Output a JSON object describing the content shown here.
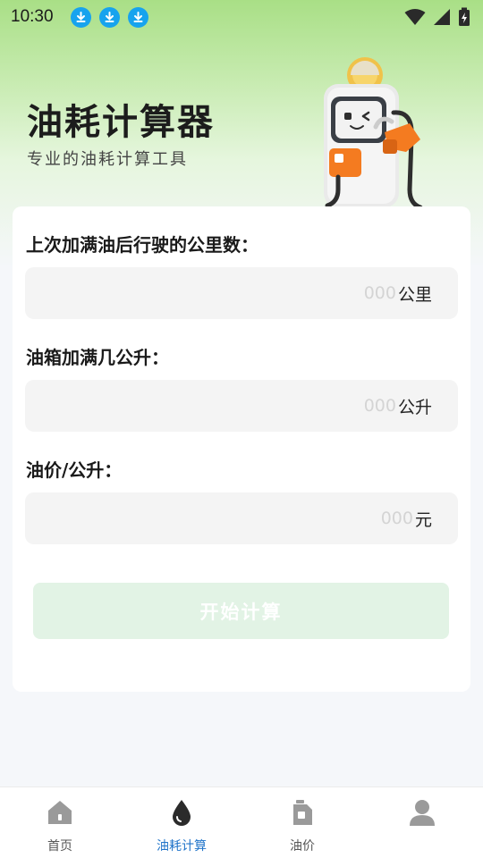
{
  "status_bar": {
    "time": "10:30",
    "notification_icons": [
      "download-icon",
      "download-icon",
      "download-icon"
    ],
    "right_icons": [
      "wifi-icon",
      "signal-icon",
      "battery-charging-icon"
    ]
  },
  "header": {
    "title": "油耗计算器",
    "subtitle": "专业的油耗计算工具",
    "mascot": "fuel-pump-robot-mascot"
  },
  "form": {
    "distance": {
      "label": "上次加满油后行驶的公里数：",
      "placeholder": "000",
      "value": "",
      "unit": "公里"
    },
    "fuel": {
      "label": "油箱加满几公升：",
      "placeholder": "000",
      "value": "",
      "unit": "公升"
    },
    "price": {
      "label": "油价/公升：",
      "placeholder": "000",
      "value": "",
      "unit": "元"
    },
    "submit_label": "开始计算"
  },
  "tabbar": {
    "active_index": 1,
    "items": [
      {
        "label": "首页",
        "icon": "home-icon"
      },
      {
        "label": "油耗计算",
        "icon": "oil-drop-icon"
      },
      {
        "label": "油价",
        "icon": "fuel-can-icon"
      },
      {
        "label": "",
        "icon": "profile-icon"
      }
    ]
  },
  "colors": {
    "accent": "#1f73c9",
    "hero_green": "#a9df86",
    "button_bg": "#e2f3e5",
    "download_badge": "#17a3ee",
    "mascot_orange": "#f47b20"
  }
}
